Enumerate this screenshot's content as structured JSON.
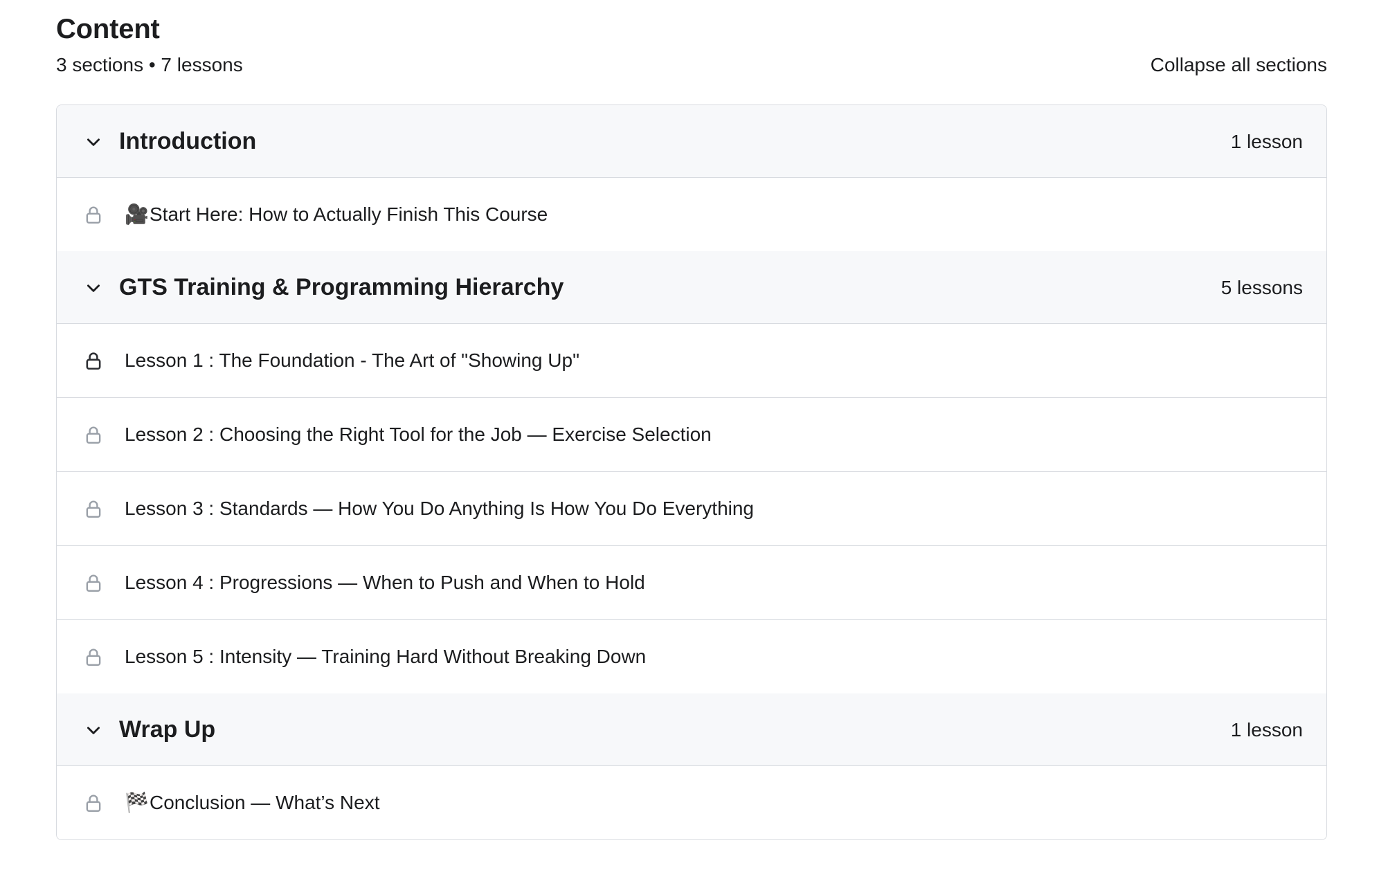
{
  "header": {
    "title": "Content",
    "summary": "3 sections • 7 lessons",
    "collapse_all_label": "Collapse all sections"
  },
  "colors": {
    "text": "#1c1d1f",
    "section_bg": "#f7f8fa",
    "border": "#d8dbe0",
    "lock_icon_normal": "#9aa0a8",
    "lock_icon_emphasized": "#2d2f33"
  },
  "sections": [
    {
      "title": "Introduction",
      "count": "1 lesson",
      "lessons": [
        {
          "emoji": "🎥",
          "title": "Start Here: How to Actually Finish This Course",
          "icon": "lock-icon"
        }
      ]
    },
    {
      "title": "GTS Training & Programming Hierarchy",
      "count": "5 lessons",
      "lessons": [
        {
          "emoji": "",
          "title": "Lesson 1 : The Foundation - The Art of \"Showing Up\"",
          "icon": "lock-icon"
        },
        {
          "emoji": "",
          "title": "Lesson 2 : Choosing the Right Tool for the Job — Exercise Selection",
          "icon": "lock-icon"
        },
        {
          "emoji": "",
          "title": "Lesson 3 : Standards — How You Do Anything Is How You Do Everything",
          "icon": "lock-icon"
        },
        {
          "emoji": "",
          "title": "Lesson 4 : Progressions — When to Push and When to Hold",
          "icon": "lock-icon"
        },
        {
          "emoji": "",
          "title": "Lesson 5 : Intensity — Training Hard Without Breaking Down",
          "icon": "lock-icon"
        }
      ]
    },
    {
      "title": "Wrap Up",
      "count": "1 lesson",
      "lessons": [
        {
          "emoji": "🏁",
          "title": "Conclusion — What’s Next",
          "icon": "lock-icon"
        }
      ]
    }
  ]
}
